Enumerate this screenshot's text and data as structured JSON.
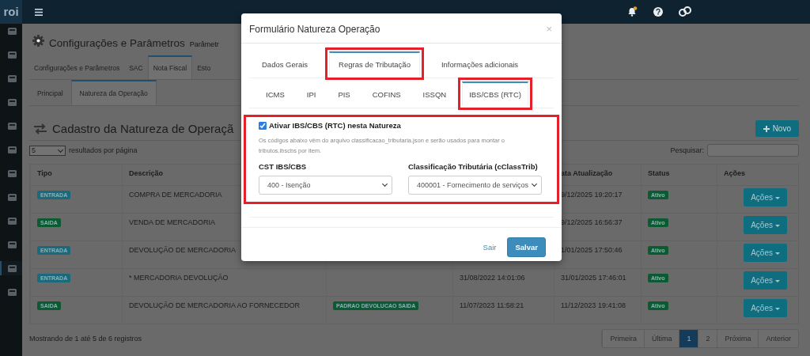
{
  "top_bar": {
    "logo": "roi"
  },
  "sidebar": {
    "items": [
      {
        "selected": false
      },
      {
        "selected": false
      },
      {
        "selected": false
      },
      {
        "selected": false
      },
      {
        "selected": false
      },
      {
        "selected": false
      },
      {
        "selected": false
      },
      {
        "selected": false
      },
      {
        "selected": false
      },
      {
        "selected": false
      },
      {
        "selected": true
      },
      {
        "selected": false
      }
    ]
  },
  "page": {
    "title": "Configurações e Parâmetros",
    "subtitle": "Parâmetr",
    "tabs": [
      {
        "label": "Configurações e Parâmetros",
        "selected": false
      },
      {
        "label": "SAC",
        "selected": false
      },
      {
        "label": "Nota Fiscal",
        "selected": true
      },
      {
        "label": "Esto",
        "selected": false
      }
    ],
    "subtabs": [
      {
        "label": "Principal",
        "selected": false
      },
      {
        "label": "Natureza da Operação",
        "selected": true
      }
    ],
    "section_title": "Cadastro da Natureza de Operaçã",
    "new_button": "Novo",
    "page_size": "5",
    "page_size_label": "resultados por página",
    "search_label": "Pesquisar:"
  },
  "table": {
    "columns": [
      "Tipo",
      "Descrição",
      null,
      null,
      "ata Atualização",
      "Status",
      "Ações"
    ],
    "rows": [
      {
        "type": {
          "label": "ENTRADA",
          "color": "#1b6a7c"
        },
        "description": "COMPRA DE MERCADORIA",
        "updated": "9/12/2025 19:20:17",
        "status": "Ativo",
        "action": "Ações"
      },
      {
        "type": {
          "label": "SAIDA",
          "color": "#0b5a32"
        },
        "description": "VENDA DE MERCADORIA",
        "updated": "9/12/2025 16:56:37",
        "status": "Ativo",
        "action": "Ações"
      },
      {
        "type": {
          "label": "ENTRADA",
          "color": "#1b6a7c"
        },
        "description": "DEVOLUÇÃO DE MERCADORIA",
        "updated": "1/01/2025 17:50:46",
        "status": "Ativo",
        "action": "Ações"
      },
      {
        "type": {
          "label": "ENTRADA",
          "color": "#1b6a7c"
        },
        "description": "* MERCADORIA DEVOLUÇÃO",
        "created": "31/08/2022 14:01:06",
        "updated": "31/01/2025 17:46:01",
        "status": "Ativo",
        "action": "Ações"
      },
      {
        "type": {
          "label": "SAIDA",
          "color": "#0b5a32"
        },
        "description": "DEVOLUÇÃO DE MERCADORIA AO FORNECEDOR",
        "tag": "PADRAO DEVOLUCAO SAIDA",
        "created": "11/07/2023 11:58:21",
        "updated": "11/12/2023 19:41:08",
        "status": "Ativo",
        "action": "Ações"
      }
    ]
  },
  "footer_text": "Mostrando de 1 até 5 de 6 registros",
  "pagination": [
    {
      "label": "Primeira",
      "selected": false
    },
    {
      "label": "Última",
      "selected": false
    },
    {
      "label": "1",
      "selected": true
    },
    {
      "label": "2",
      "selected": false
    },
    {
      "label": "Próxima",
      "selected": false
    },
    {
      "label": "Anterior",
      "selected": false
    }
  ],
  "modal": {
    "title": "Formulário Natureza Operação",
    "close": "×",
    "tabs": [
      {
        "label": "Dados Gerais",
        "selected": false,
        "highlighted": false
      },
      {
        "label": "Regras de Tributação",
        "selected": true,
        "highlighted": true
      },
      {
        "label": "Informações adicionais",
        "selected": false,
        "highlighted": false
      }
    ],
    "subtabs": [
      {
        "label": "ICMS",
        "selected": false,
        "highlighted": false
      },
      {
        "label": "IPI",
        "selected": false,
        "highlighted": false
      },
      {
        "label": "PIS",
        "selected": false,
        "highlighted": false
      },
      {
        "label": "COFINS",
        "selected": false,
        "highlighted": false
      },
      {
        "label": "ISSQN",
        "selected": false,
        "highlighted": false
      },
      {
        "label": "IBS/CBS (RTC)",
        "selected": true,
        "highlighted": true
      }
    ],
    "panel_highlighted": true,
    "checkbox": {
      "label": "Ativar IBS/CBS (RTC) nesta Natureza",
      "checked": true
    },
    "help_text": "Os códigos abaixo vêm do arquivo classificacao_tributaria.json e serão usados para montar o tributos.ibscbs por item.",
    "fields": [
      {
        "label": "CST IBS/CBS",
        "value": "400 - Isenção"
      },
      {
        "label": "Classificação Tributária (cClassTrib)",
        "value": "400001 - Fornecimento de serviços"
      }
    ],
    "cancel": "Sair",
    "save": "Salvar"
  }
}
